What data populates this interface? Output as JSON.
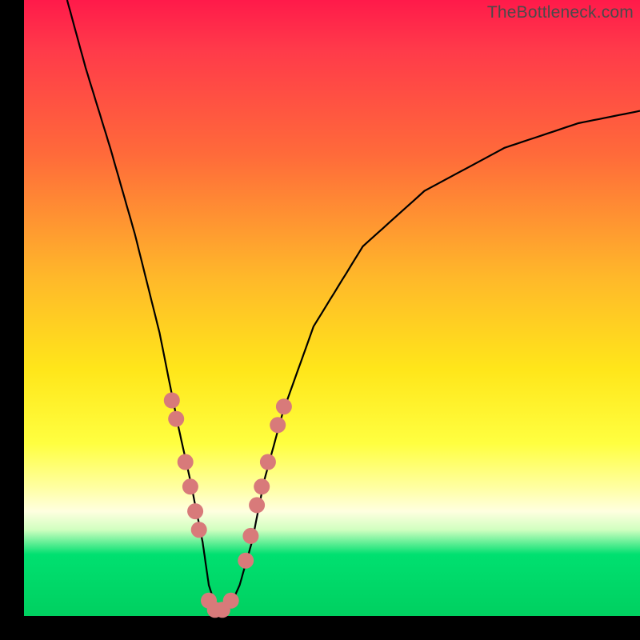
{
  "watermark": "TheBottleneck.com",
  "chart_data": {
    "type": "line",
    "title": "",
    "xlabel": "",
    "ylabel": "",
    "xlim": [
      0,
      100
    ],
    "ylim": [
      0,
      100
    ],
    "series": [
      {
        "name": "bottleneck-curve",
        "x": [
          7,
          10,
          14,
          18,
          22,
          25,
          27,
          29,
          30,
          31.5,
          33,
          35,
          37,
          39,
          42,
          47,
          55,
          65,
          78,
          90,
          100
        ],
        "y": [
          100,
          89,
          76,
          62,
          46,
          31,
          22,
          12,
          5,
          0.5,
          0.5,
          5,
          12,
          22,
          33,
          47,
          60,
          69,
          76,
          80,
          82
        ]
      }
    ],
    "markers": {
      "name": "highlight-dots",
      "color": "#d87a7a",
      "points": [
        {
          "x": 24.0,
          "y": 35
        },
        {
          "x": 24.7,
          "y": 32
        },
        {
          "x": 26.2,
          "y": 25
        },
        {
          "x": 27.0,
          "y": 21
        },
        {
          "x": 27.8,
          "y": 17
        },
        {
          "x": 28.4,
          "y": 14
        },
        {
          "x": 30.0,
          "y": 2.5
        },
        {
          "x": 31.0,
          "y": 1.0
        },
        {
          "x": 32.2,
          "y": 1.0
        },
        {
          "x": 33.6,
          "y": 2.5
        },
        {
          "x": 36.0,
          "y": 9
        },
        {
          "x": 36.8,
          "y": 13
        },
        {
          "x": 37.8,
          "y": 18
        },
        {
          "x": 38.6,
          "y": 21
        },
        {
          "x": 39.6,
          "y": 25
        },
        {
          "x": 41.2,
          "y": 31
        },
        {
          "x": 42.2,
          "y": 34
        }
      ]
    },
    "gradient_stops": [
      {
        "pos": 0,
        "color": "#ff1a4a"
      },
      {
        "pos": 25,
        "color": "#ff6a3a"
      },
      {
        "pos": 60,
        "color": "#ffe61a"
      },
      {
        "pos": 83,
        "color": "#ffffe0"
      },
      {
        "pos": 90,
        "color": "#00e070"
      },
      {
        "pos": 100,
        "color": "#00d060"
      }
    ]
  }
}
